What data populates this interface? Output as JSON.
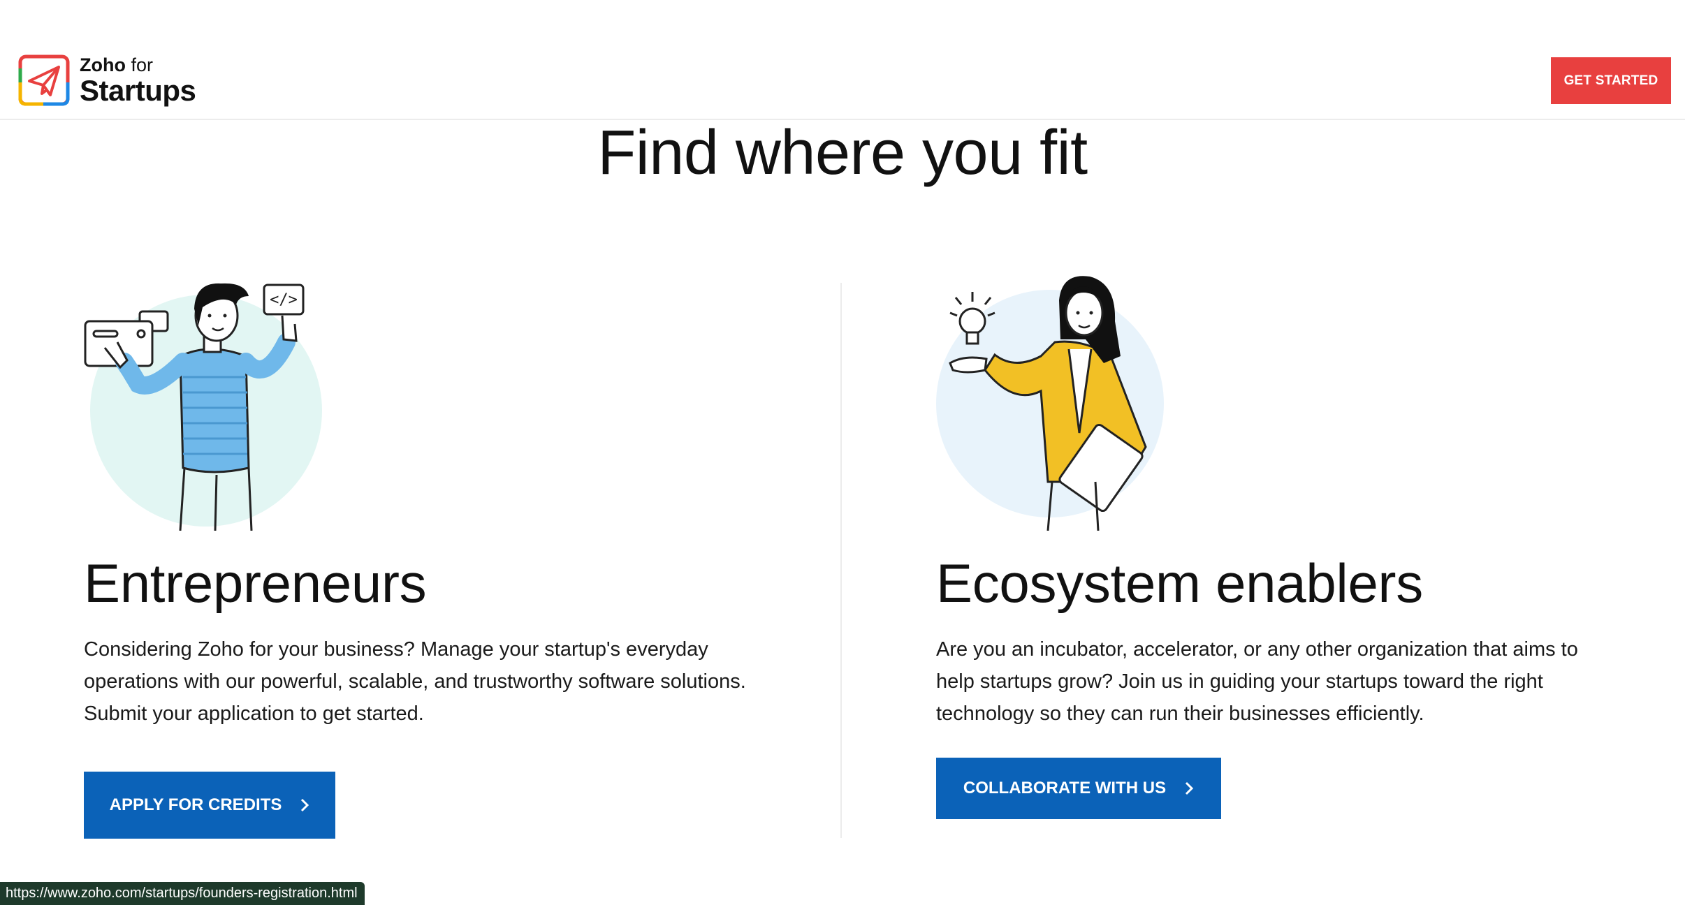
{
  "header": {
    "brand_line1_bold": "Zoho",
    "brand_line1_rest": " for",
    "brand_line2": "Startups",
    "get_started_label": "GET STARTED"
  },
  "hero": {
    "title": "Find where you fit"
  },
  "cards": [
    {
      "title": "Entrepreneurs",
      "description": "Considering Zoho for your business? Manage your startup's everyday operations with our powerful, scalable, and trustworthy software solutions. Submit your application to get started.",
      "cta_label": "APPLY FOR CREDITS",
      "illustration_icon": "man-with-cards-illustration"
    },
    {
      "title": "Ecosystem enablers",
      "description": "Are you an incubator, accelerator, or any other organization that aims to help startups grow? Join us in guiding your startups toward the right technology so they can run their businesses efficiently.",
      "cta_label": "COLLABORATE WITH US",
      "illustration_icon": "woman-with-lightbulb-illustration"
    }
  ],
  "status_bar": {
    "url": "https://www.zoho.com/startups/founders-registration.html"
  },
  "colors": {
    "accent_red": "#e8403f",
    "cta_blue": "#0b62b8",
    "status_bg": "#1e3a2b"
  }
}
